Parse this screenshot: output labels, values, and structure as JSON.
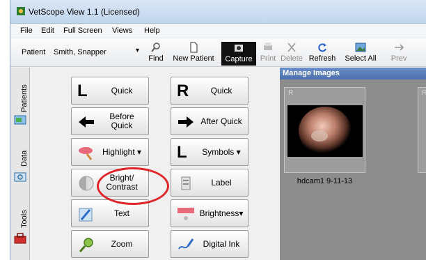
{
  "window": {
    "title": "VetScope View 1.1 (Licensed)"
  },
  "menu": [
    "File",
    "Edit",
    "Full Screen",
    "Views",
    "Help"
  ],
  "toolbar": {
    "patient_label": "Patient",
    "patient_value": "Smith, Snapper",
    "buttons": {
      "find": "Find",
      "new_patient": "New Patient",
      "capture": "Capture",
      "print": "Print",
      "delete": "Delete",
      "refresh": "Refresh",
      "select_all": "Select All",
      "preview": "Prev"
    }
  },
  "side_tabs": [
    "Patients",
    "Data",
    "Tools"
  ],
  "tools": {
    "quick_l": {
      "glyph": "L",
      "label": "Quick"
    },
    "quick_r": {
      "glyph": "R",
      "label": "Quick"
    },
    "before_quick": "Before Quick",
    "after_quick": "After Quick",
    "highlight": "Highlight",
    "symbols": {
      "glyph": "L",
      "label": "Symbols"
    },
    "bright_contrast": "Bright/ Contrast",
    "label": "Label",
    "text": "Text",
    "brightness": "Brightness",
    "zoom": "Zoom",
    "digital_ink": "Digital Ink",
    "dropdown_marker": "▾"
  },
  "images": {
    "header": "Manage Images",
    "thumbnails": [
      {
        "tag": "R",
        "caption": "hdcam1 9-11-13"
      },
      {
        "tag": "R",
        "caption": ""
      }
    ]
  },
  "colors": {
    "accent": "#e0252b",
    "header": "#4c6fae",
    "panel": "#8d8d8d"
  }
}
